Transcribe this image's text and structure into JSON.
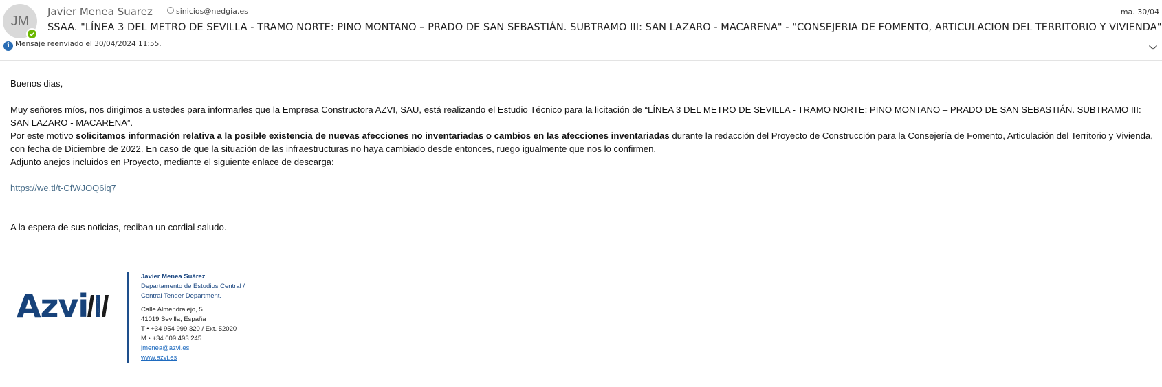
{
  "header": {
    "avatar_initials": "JM",
    "sender_name": "Javier Menea Suarez",
    "sender_email": "sinicios@nedgia.es",
    "date": "ma. 30/04",
    "subject": "SSAA. \"LÍNEA 3 DEL METRO DE SEVILLA - TRAMO NORTE: PINO MONTANO – PRADO DE SAN SEBASTIÁN. SUBTRAMO III: SAN LAZARO - MACARENA\" - \"CONSEJERIA DE FOMENTO, ARTICULACION DEL TERRITORIO Y VIVIENDA\"",
    "forward_notice": "Mensaje reenviado el 30/04/2024 11:55.",
    "info_icon": "info-icon",
    "expand_icon": "chevron-down-icon",
    "presence_color": "#6bb700"
  },
  "body": {
    "greeting": "Buenos dias,",
    "para1": "Muy señores míos, nos dirigimos a ustedes para informarles que la Empresa Constructora AZVI, SAU, está realizando el Estudio Técnico para la licitación de “LÍNEA 3 DEL METRO DE SEVILLA - TRAMO NORTE: PINO MONTANO – PRADO DE SAN SEBASTIÁN. SUBTRAMO III: SAN LAZARO - MACARENA”.",
    "para2_before": "Por este motivo ",
    "para2_bold": "solicitamos información relativa a la posible existencia de nuevas afecciones no inventariadas o cambios en las afecciones inventariadas",
    "para2_after": " durante la redacción del Proyecto de Construcción para la Consejería de Fomento, Articulación del Territorio y Vivienda, con fecha de Diciembre de 2022. En caso de que la situación de las infraestructuras no haya cambiado desde entonces, ruego igualmente que nos lo confirmen.",
    "para3": "Adjunto anejos incluidos en Proyecto, mediante el siguiente enlace de descarga:",
    "download_link": "https://we.tl/t-CfWJOQ6iq7",
    "closing": "A la espera de sus noticias, reciban un cordial saludo."
  },
  "signature": {
    "logo_text": "Azvi",
    "name": "Javier Menea Suárez",
    "dept_line1": "Departamento de Estudios Central /",
    "dept_line2": "Central Tender Department.",
    "address1": "Calle Almendralejo, 5",
    "address2": "41019 Sevilla, España",
    "phone": "T •  +34 954 999 320 / Ext. 52020",
    "mobile": "M •  +34 609 493 245",
    "email": "jmenea@azvi.es",
    "website": "www.azvi.es",
    "brand_color": "#17427a"
  }
}
